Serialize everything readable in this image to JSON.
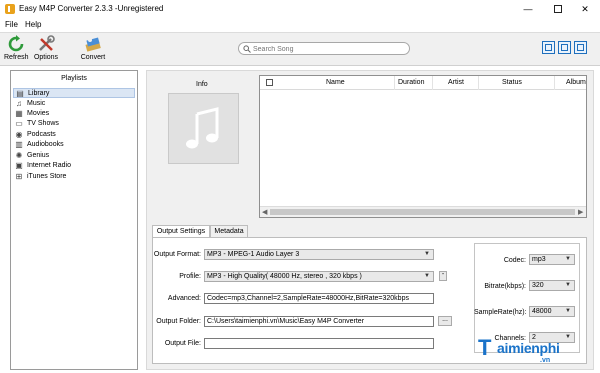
{
  "window": {
    "title": "Easy M4P Converter 2.3.3 -Unregistered",
    "controls": {
      "minimize": "—",
      "close": "✕"
    }
  },
  "menu": [
    "File",
    "Help"
  ],
  "toolbar": {
    "refresh_label": "Refresh",
    "options_label": "Options",
    "convert_label": "Convert",
    "search_placeholder": "Search Song"
  },
  "playlists": {
    "header": "Playlists",
    "items": [
      {
        "label": "Library",
        "icon": "library-icon",
        "glyph": "▤"
      },
      {
        "label": "Music",
        "icon": "music-icon",
        "glyph": "♫"
      },
      {
        "label": "Movies",
        "icon": "movies-icon",
        "glyph": "▦"
      },
      {
        "label": "TV Shows",
        "icon": "tv-icon",
        "glyph": "▭"
      },
      {
        "label": "Podcasts",
        "icon": "podcast-icon",
        "glyph": "◉"
      },
      {
        "label": "Audiobooks",
        "icon": "audiobook-icon",
        "glyph": "▥"
      },
      {
        "label": "Genius",
        "icon": "genius-icon",
        "glyph": "✺"
      },
      {
        "label": "Internet Radio",
        "icon": "radio-icon",
        "glyph": "▣"
      },
      {
        "label": "iTunes Store",
        "icon": "store-icon",
        "glyph": "⊞"
      }
    ],
    "selected": "Library"
  },
  "info": {
    "label": "Info"
  },
  "table": {
    "columns": [
      "Name",
      "Duration",
      "Artist",
      "Status",
      "Album"
    ],
    "rows": []
  },
  "tabs": [
    "Output Settings",
    "Metadata"
  ],
  "active_tab": "Output Settings",
  "output_settings": {
    "format_label": "Output Format:",
    "format_value": "MP3 - MPEG-1 Audio Layer 3",
    "profile_label": "Profile:",
    "profile_value": "MP3 - High Quality( 48000 Hz, stereo , 320 kbps  )",
    "profile_button": "-",
    "advanced_label": "Advanced:",
    "advanced_value": "Codec=mp3,Channel=2,SampleRate=48000Hz,BitRate=320kbps",
    "folder_label": "Output Folder:",
    "folder_value": "C:\\Users\\taimienphi.vn\\Music\\Easy M4P Converter",
    "folder_button": "...",
    "file_label": "Output File:",
    "file_value": ""
  },
  "codec_settings": {
    "codec_label": "Codec:",
    "codec_value": "mp3",
    "bitrate_label": "Bitrate(kbps):",
    "bitrate_value": "320",
    "samplerate_label": "SampleRate(hz):",
    "samplerate_value": "48000",
    "channels_label": "Channels:",
    "channels_value": "2"
  },
  "watermark": {
    "brand_letter": "T",
    "brand": "aimienphi",
    "domain": ".vn"
  },
  "colors": {
    "accent": "#1f6fbd",
    "selection": "#dbe6f4",
    "watermark": "#1a73c9"
  }
}
